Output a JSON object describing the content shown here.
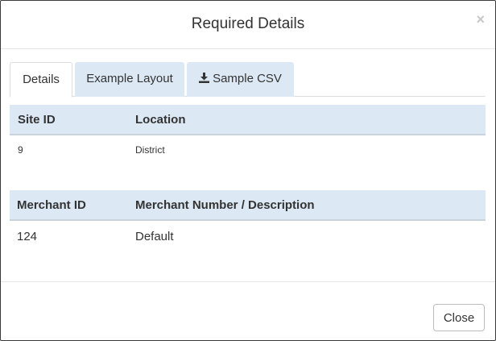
{
  "modal": {
    "title": "Required Details",
    "close_icon": "×"
  },
  "tabs": [
    {
      "label": "Details",
      "active": true
    },
    {
      "label": "Example Layout",
      "active": false
    },
    {
      "label": "Sample CSV",
      "active": false,
      "icon": "download-icon"
    }
  ],
  "site_table": {
    "headers": [
      "Site ID",
      "Location"
    ],
    "rows": [
      [
        "9",
        "District"
      ]
    ]
  },
  "merchant_table": {
    "headers": [
      "Merchant ID",
      "Merchant Number / Description"
    ],
    "rows": [
      [
        "124",
        "Default"
      ]
    ]
  },
  "footer": {
    "close_label": "Close"
  },
  "colors": {
    "tab_inactive_bg": "#dce9f5",
    "table_header_bg": "#dce9f5"
  }
}
